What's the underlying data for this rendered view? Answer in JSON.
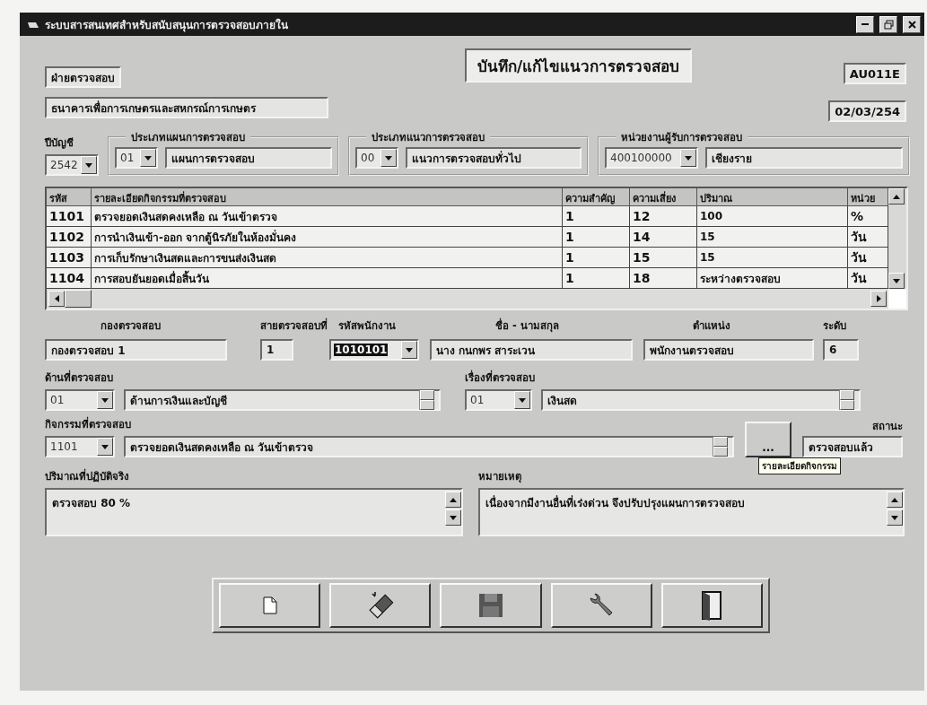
{
  "window": {
    "title": "ระบบสารสนเทศสำหรับสนับสนุนการตรวจสอบภายใน"
  },
  "header": {
    "department": "ฝ่ายตรวจสอบ",
    "organization": "ธนาคารเพื่อการเกษตรและสหกรณ์การเกษตร",
    "heading": "บันทึก/แก้ไขแนวการตรวจสอบ",
    "screen_code": "AU011E",
    "date": "02/03/254"
  },
  "fiscal_year": {
    "label": "ปีบัญชี",
    "value": "2542"
  },
  "groups": [
    {
      "label": "ประเภทแผนการตรวจสอบ",
      "code": "01",
      "name": "แผนการตรวจสอบ"
    },
    {
      "label": "ประเภทแนวการตรวจสอบ",
      "code": "00",
      "name": "แนวการตรวจสอบทั่วไป"
    },
    {
      "label": "หน่วยงานผู้รับการตรวจสอบ",
      "code": "400100000",
      "name": "เชียงราย"
    }
  ],
  "table": {
    "columns": [
      "รหัส",
      "รายละเอียดกิจกรรมที่ตรวจสอบ",
      "ความสำคัญ",
      "ความเสี่ยง",
      "ปริมาณ",
      "หน่วย"
    ],
    "rows": [
      [
        "1101",
        "ตรวจยอดเงินสดคงเหลือ ณ วันเข้าตรวจ",
        "1",
        "12",
        "100",
        "%"
      ],
      [
        "1102",
        "การนำเงินเข้า-ออก จากตู้นิรภัยในห้องมั่นคง",
        "1",
        "14",
        "15",
        "วัน"
      ],
      [
        "1103",
        "การเก็บรักษาเงินสดและการขนส่งเงินสด",
        "1",
        "15",
        "15",
        "วัน"
      ],
      [
        "1104",
        "การสอบยันยอดเมื่อสิ้นวัน",
        "1",
        "18",
        "ระหว่างตรวจสอบ",
        "วัน"
      ]
    ]
  },
  "employee_fields": [
    {
      "label": "กองตรวจสอบ",
      "value": "กองตรวจสอบ 1",
      "kind": "text",
      "highlighted": false
    },
    {
      "label": "สายตรวจสอบที่",
      "value": "1",
      "kind": "text",
      "highlighted": false
    },
    {
      "label": "รหัสพนักงาน",
      "value": "1010101",
      "kind": "combo",
      "highlighted": true
    },
    {
      "label": "ชื่อ - นามสกุล",
      "value": "นาง กนกพร สาระเวน",
      "kind": "text",
      "highlighted": false
    },
    {
      "label": "ตำแหน่ง",
      "value": "พนักงานตรวจสอบ",
      "kind": "text",
      "highlighted": false
    },
    {
      "label": "ระดับ",
      "value": "6",
      "kind": "text",
      "highlighted": false
    }
  ],
  "aspect": {
    "label": "ด้านที่ตรวจสอบ",
    "code": "01",
    "name": "ด้านการเงินและบัญชี"
  },
  "topic": {
    "label": "เรื่องที่ตรวจสอบ",
    "code": "01",
    "name": "เงินสด"
  },
  "activity": {
    "label": "กิจกรรมที่ตรวจสอบ",
    "code": "1101",
    "name": "ตรวจยอดเงินสดคงเหลือ ณ วันเข้าตรวจ"
  },
  "detail_button": {
    "label": "...",
    "tooltip": "รายละเอียดกิจกรรม"
  },
  "status": {
    "label": "สถานะ",
    "value": "ตรวจสอบแล้ว"
  },
  "actual_amount": {
    "label": "ปริมาณที่ปฏิบัติจริง",
    "value": "ตรวจสอบ 80 %"
  },
  "remarks": {
    "label": "หมายเหตุ",
    "value": "เนื่องจากมีงานอื่นที่เร่งด่วน จึงปรับปรุงแผนการตรวจสอบ"
  },
  "toolbar": [
    {
      "kind": "new"
    },
    {
      "kind": "clear"
    },
    {
      "kind": "save"
    },
    {
      "kind": "tools"
    },
    {
      "kind": "exit"
    }
  ]
}
